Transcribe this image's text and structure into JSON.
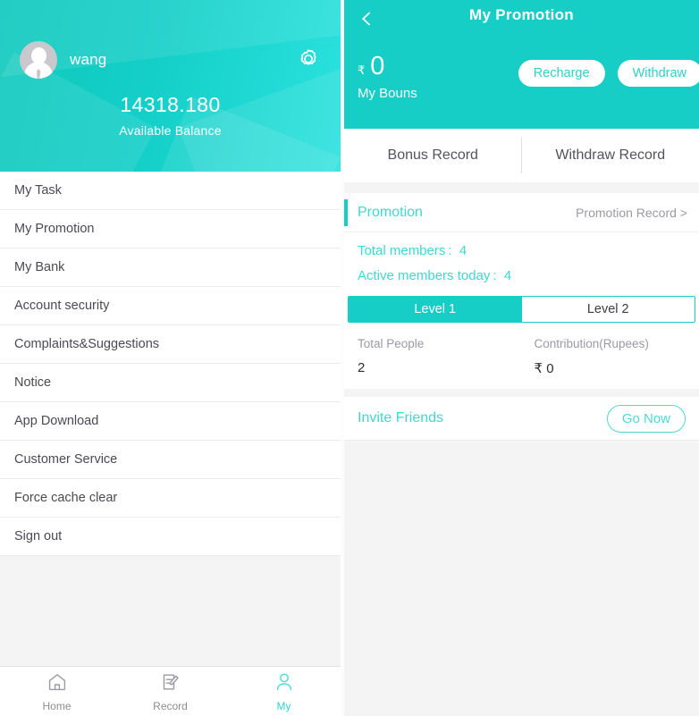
{
  "left": {
    "profile": {
      "username": "wang",
      "avatar_icon": "user-avatar-icon",
      "settings_icon": "gear-icon",
      "balance_amount": "14318.180",
      "balance_label": "Available Balance",
      "gradient_from": "#0fc9bd",
      "gradient_to": "#2be2de"
    },
    "menu": [
      {
        "label": "My Task"
      },
      {
        "label": "My Promotion"
      },
      {
        "label": "My Bank"
      },
      {
        "label": "Account security"
      },
      {
        "label": "Complaints&Suggestions"
      },
      {
        "label": "Notice"
      },
      {
        "label": "App Download"
      },
      {
        "label": "Customer Service"
      },
      {
        "label": "Force cache clear"
      },
      {
        "label": "Sign out"
      }
    ],
    "tabbar": [
      {
        "label": "Home",
        "icon": "home-icon",
        "active": false
      },
      {
        "label": "Record",
        "icon": "record-icon",
        "active": false
      },
      {
        "label": "My",
        "icon": "person-icon",
        "active": true
      }
    ],
    "tabbar_active_color": "#2fd4d0"
  },
  "right": {
    "header": {
      "back_icon": "back-chevron-icon",
      "title": "My Promotion",
      "bonus_currency": "₹",
      "bonus_value": "0",
      "bonus_label": "My Bouns",
      "recharge_label": "Recharge",
      "withdraw_label": "Withdraw",
      "background": "#16cec5"
    },
    "record_tabs": [
      {
        "label": "Bonus Record"
      },
      {
        "label": "Withdraw Record"
      }
    ],
    "promotion": {
      "title": "Promotion",
      "record_link": "Promotion Record >",
      "total_members_label": "Total members :",
      "total_members_value": "4",
      "active_members_label": "Active members today :",
      "active_members_value": "4",
      "accent_color": "#16cec5"
    },
    "level_tabs": [
      {
        "label": "Level 1",
        "active": true
      },
      {
        "label": "Level 2",
        "active": false
      }
    ],
    "stats": {
      "columns": [
        {
          "header": "Total People",
          "value": "2"
        },
        {
          "header": "Contribution(Rupees)",
          "value": "₹ 0"
        }
      ]
    },
    "invite": {
      "label": "Invite Friends",
      "button_label": "Go Now"
    }
  }
}
